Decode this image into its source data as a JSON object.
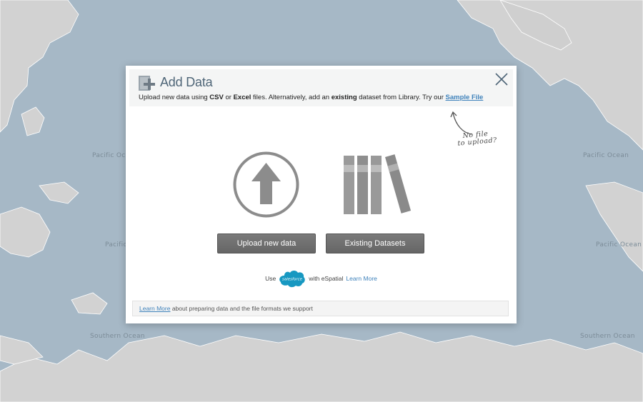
{
  "map": {
    "ocean_labels": {
      "pacific_left": "Pacific Ocean",
      "pacific_right": "Pacific Ocean",
      "pacific_mid_left": "Pacific",
      "pacific_mid_right": "Pacific Ocean",
      "southern_left": "Southern Ocean",
      "southern_right": "Southern Ocean"
    },
    "colors": {
      "water": "#a6b8c6",
      "land": "#d2d2d2"
    }
  },
  "dialog": {
    "title": "Add Data",
    "subtitle": {
      "part1": "Upload new data using ",
      "csv": "CSV",
      "part2": " or ",
      "excel": "Excel",
      "part3": " files. Alternatively, add an ",
      "existing": "existing",
      "part4": " dataset from Library. Try our ",
      "sample_link": "Sample File"
    },
    "hint": {
      "line1": "No file",
      "line2": "to upload?"
    },
    "upload_button": "Upload new data",
    "existing_button": "Existing Datasets",
    "salesforce": {
      "prefix": "Use",
      "logo_text": "salesforce",
      "suffix": "with eSpatial",
      "link": "Learn More"
    },
    "footer": {
      "link": "Learn More",
      "text": " about preparing data and the file formats we support"
    },
    "icons": {
      "header": "add-data-icon",
      "close": "close-icon",
      "upload": "upload-arrow-icon",
      "library": "library-books-icon",
      "hint": "curved-arrow-icon"
    },
    "colors": {
      "title": "#4e6577",
      "link": "#3f82bb",
      "button": "#707070",
      "salesforce": "#1798c1"
    }
  }
}
